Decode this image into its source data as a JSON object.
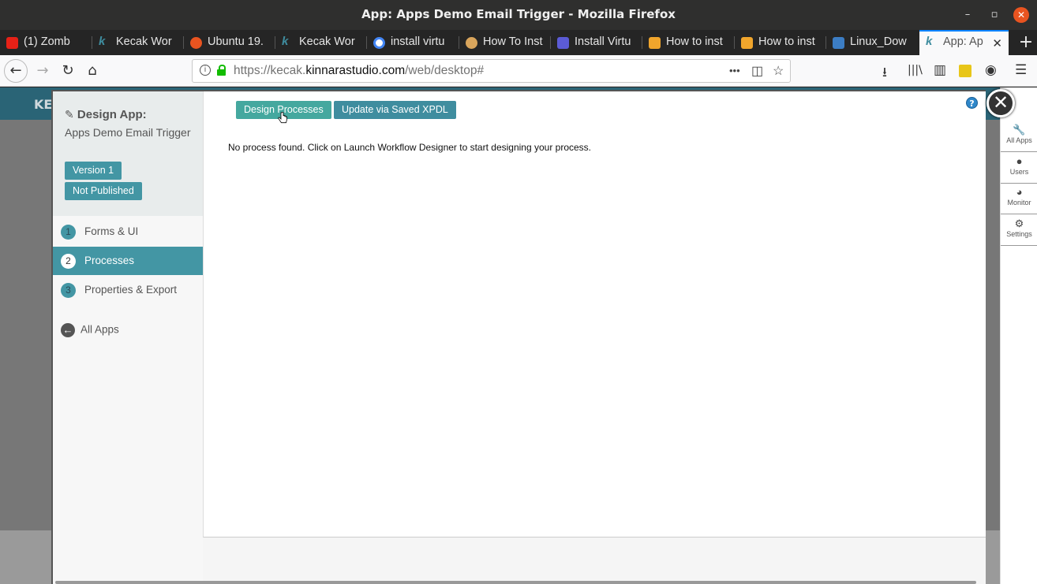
{
  "window": {
    "title": "App: Apps Demo Email Trigger - Mozilla Firefox",
    "minimize": "–",
    "maximize": "▫",
    "close": "✕"
  },
  "tabs": [
    {
      "label": "(1) Zomb",
      "icon_color": "#e62117",
      "icon": "youtube-icon"
    },
    {
      "label": "Kecak Wor",
      "icon_color": "#3f8d9f",
      "icon": "kecak-icon"
    },
    {
      "label": "Ubuntu 19.",
      "icon_color": "#e95420",
      "icon": "ubuntu-icon"
    },
    {
      "label": "Kecak Wor",
      "icon_color": "#3f8d9f",
      "icon": "kecak-icon"
    },
    {
      "label": "install virtu",
      "icon_color": "#4285f4",
      "icon": "google-icon"
    },
    {
      "label": "How To Inst",
      "icon_color": "#d9a55c",
      "icon": "site-icon"
    },
    {
      "label": "Install Virtu",
      "icon_color": "#5b5bd6",
      "icon": "site-icon"
    },
    {
      "label": "How to inst",
      "icon_color": "#f0a52c",
      "icon": "foss-linux-icon"
    },
    {
      "label": "How to inst",
      "icon_color": "#f0a52c",
      "icon": "foss-linux-icon"
    },
    {
      "label": "Linux_Dow",
      "icon_color": "#3c7dc4",
      "icon": "site-icon"
    },
    {
      "label": "App: Ap",
      "icon_color": "#3f8d9f",
      "icon": "kecak-icon",
      "active": true
    }
  ],
  "tab_close": "✕",
  "new_tab": "+",
  "nav": {
    "url_host_prefix": "https://kecak.",
    "url_host": "kinnarastudio.com",
    "url_path": "/web/desktop#",
    "back": "←",
    "forward": "→",
    "reload": "↻",
    "home": "⌂",
    "more": "•••",
    "pocket": "◫",
    "star": "☆",
    "download": "⭳",
    "library": "|||\\",
    "sidebar": "▥",
    "account": "◉",
    "menu": "☰",
    "info": "i"
  },
  "page": {
    "header_text": "KE"
  },
  "rail": [
    {
      "label": "All Apps",
      "glyph": "🔧"
    },
    {
      "label": "Users",
      "glyph": "●"
    },
    {
      "label": "Monitor",
      "glyph": "◕"
    },
    {
      "label": "Settings",
      "glyph": "⚙"
    }
  ],
  "sidebar": {
    "heading": "Design App:",
    "app_name": "Apps Demo Email Trigger",
    "version": "Version 1",
    "status": "Not Published",
    "steps": [
      {
        "num": "1",
        "label": "Forms & UI"
      },
      {
        "num": "2",
        "label": "Processes",
        "active": true
      },
      {
        "num": "3",
        "label": "Properties & Export"
      }
    ],
    "all_apps": "All Apps"
  },
  "content": {
    "design_button": "Design Processes",
    "update_button": "Update via Saved XPDL",
    "message": "No process found. Click on Launch Workflow Designer to start designing your process.",
    "help": "?"
  },
  "close_modal": "✕"
}
